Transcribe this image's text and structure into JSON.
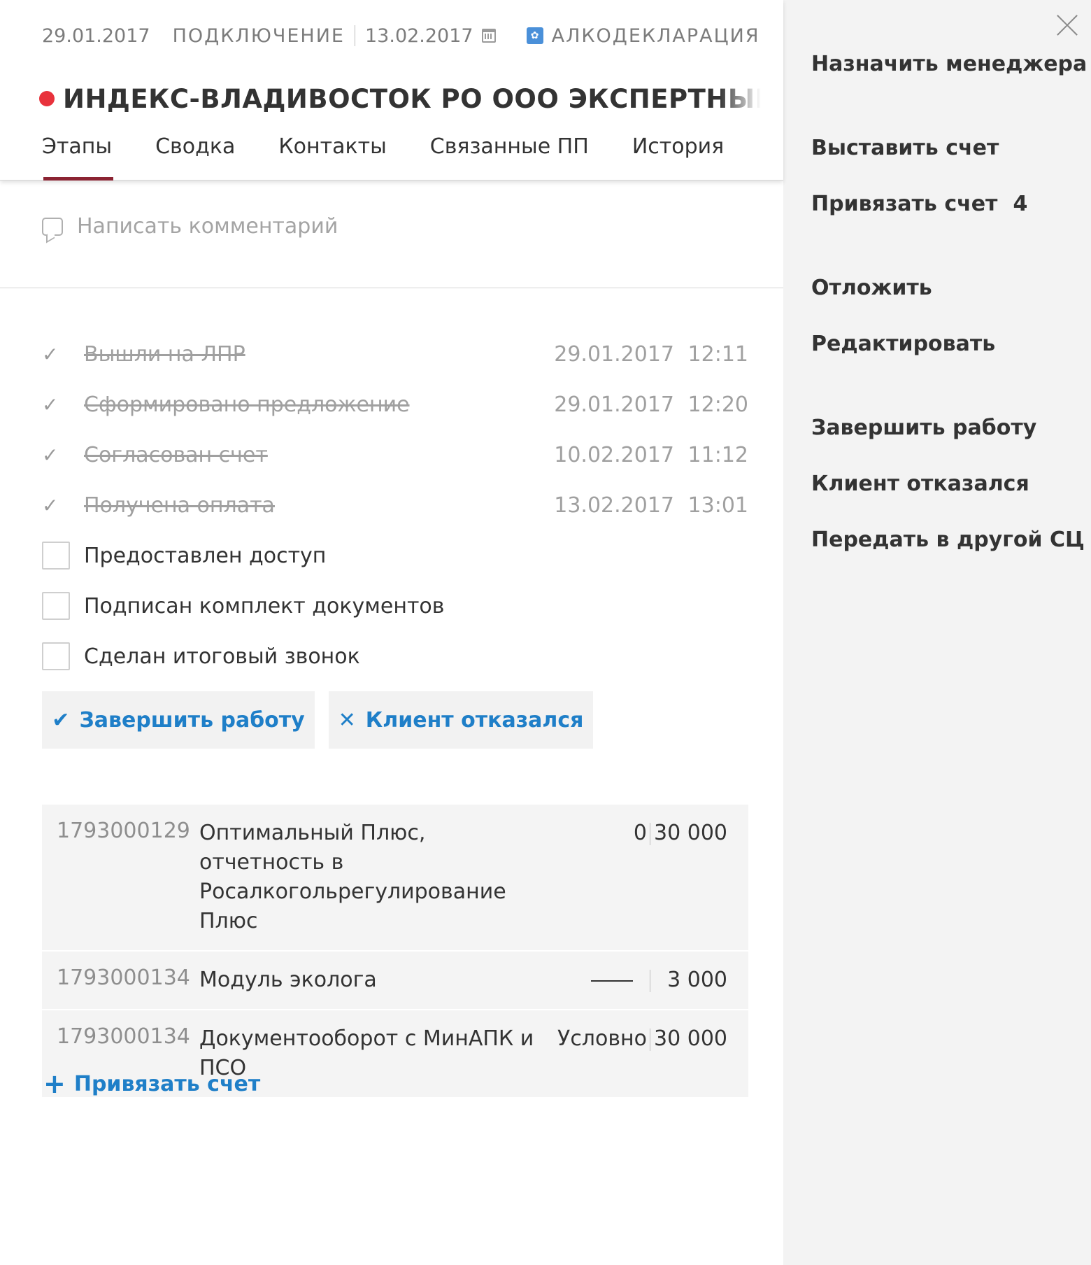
{
  "header": {
    "created_date": "29.01.2017",
    "stage": "ПОДКЛЮЧЕНИЕ",
    "due_date": "13.02.2017",
    "product": "АЛКОДЕКЛАРАЦИЯ",
    "product_icon": "grapes-icon",
    "status_color": "#e8323c",
    "company": "ИНДЕКС-ВЛАДИВОСТОК РО ООО ЭКСПЕРТНЫЙ ЦЕНТР ИН"
  },
  "tabs": [
    {
      "label": "Этапы",
      "active": true
    },
    {
      "label": "Сводка",
      "active": false
    },
    {
      "label": "Контакты",
      "active": false
    },
    {
      "label": "Связанные ПП",
      "active": false
    },
    {
      "label": "История",
      "active": false
    }
  ],
  "comment": {
    "placeholder": "Написать комментарий"
  },
  "stages": [
    {
      "label": "Вышли на ЛПР",
      "done": true,
      "date": "29.01.2017 12:11"
    },
    {
      "label": "Сформировано предложение",
      "done": true,
      "date": "29.01.2017 12:20"
    },
    {
      "label": "Согласован счет",
      "done": true,
      "date": "10.02.2017 11:12"
    },
    {
      "label": "Получена оплата",
      "done": true,
      "date": "13.02.2017 13:01"
    },
    {
      "label": "Предоставлен доступ",
      "done": false
    },
    {
      "label": "Подписан комплект документов",
      "done": false
    },
    {
      "label": "Сделан итоговый звонок",
      "done": false
    }
  ],
  "actions": {
    "finish": "Завершить работу",
    "refuse": "Клиент отказался"
  },
  "invoices": [
    {
      "number": "1793000129",
      "name": "Оптимальный Плюс, отчетность в Росалкогольрегулирование Плюс",
      "status": "0",
      "sum": "30 000"
    },
    {
      "number": "1793000134",
      "name": "Модуль эколога",
      "status": "",
      "sum": "3 000"
    },
    {
      "number": "1793000134",
      "name": "Документооборот с МинАПК и ПСО",
      "status": "Условно",
      "sum": "30 000"
    }
  ],
  "bind_invoice": "Привязать счет",
  "sidepanel": {
    "assign_manager": "Назначить менеджера",
    "issue_invoice": "Выставить счет",
    "bind_invoice": "Привязать счет",
    "bind_invoice_count": "4",
    "postpone": "Отложить",
    "edit": "Редактировать",
    "finish": "Завершить работу",
    "refused": "Клиент отказался",
    "transfer": "Передать в другой СЦ"
  },
  "colors": {
    "accent": "#1f7fc8",
    "tab_underline": "#8b2332",
    "panel_bg": "#f3f3f3"
  }
}
